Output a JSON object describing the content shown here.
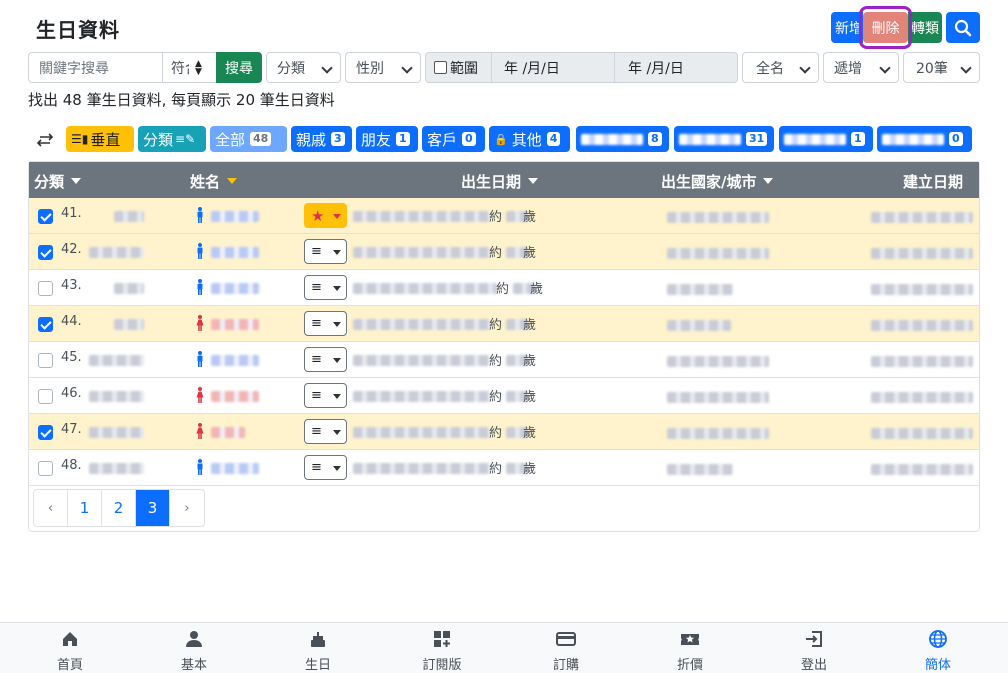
{
  "header": {
    "title": "生日資料",
    "new_label": "新增",
    "delete_label": "刪除",
    "classify_label": "轉類"
  },
  "filters": {
    "keyword_placeholder": "關鍵字搜尋",
    "match_value": "符合",
    "search_label": "搜尋",
    "category_value": "分類",
    "gender_value": "性別",
    "range_label": "範圍",
    "date_from": "年 /月/日",
    "date_to": "年 /月/日",
    "name_mode": "全名",
    "sort_value": "遞增",
    "page_size": "20筆"
  },
  "summary": "找出 48 筆生日資料, 每頁顯示 20 筆生日資料",
  "chips": {
    "vertical": "垂直",
    "classify": "分類",
    "all": {
      "label": "全部",
      "count": "48"
    },
    "relatives": {
      "label": "親戚",
      "count": "3"
    },
    "friends": {
      "label": "朋友",
      "count": "1"
    },
    "clients": {
      "label": "客戶",
      "count": "0"
    },
    "other": {
      "label": "其他",
      "count": "4"
    },
    "hidden1": {
      "count": "8"
    },
    "hidden2": {
      "count": "31"
    },
    "hidden3": {
      "count": "1"
    },
    "hidden4": {
      "count": "0"
    }
  },
  "table": {
    "headers": {
      "category": "分類",
      "name": "姓名",
      "birthdate": "出生日期",
      "birthplace": "出生國家/城市",
      "created": "建立日期"
    },
    "rows": [
      {
        "num": "41.",
        "checked": true,
        "gender": "male",
        "starred": true,
        "approx": "約",
        "age_unit": "歲"
      },
      {
        "num": "42.",
        "checked": true,
        "gender": "male",
        "starred": false,
        "approx": "約",
        "age_unit": "歲"
      },
      {
        "num": "43.",
        "checked": false,
        "gender": "male",
        "starred": false,
        "approx": "約",
        "age_unit": "歲"
      },
      {
        "num": "44.",
        "checked": true,
        "gender": "female",
        "starred": false,
        "approx": "約",
        "age_unit": "歲"
      },
      {
        "num": "45.",
        "checked": false,
        "gender": "male",
        "starred": false,
        "approx": "約",
        "age_unit": "歲"
      },
      {
        "num": "46.",
        "checked": false,
        "gender": "female",
        "starred": false,
        "approx": "約",
        "age_unit": "歲"
      },
      {
        "num": "47.",
        "checked": true,
        "gender": "female",
        "starred": false,
        "approx": "約",
        "age_unit": "歲"
      },
      {
        "num": "48.",
        "checked": false,
        "gender": "male",
        "starred": false,
        "approx": "約",
        "age_unit": "歲"
      }
    ]
  },
  "pagination": {
    "prev": "‹",
    "pages": [
      "1",
      "2",
      "3"
    ],
    "current": "3",
    "next": "›"
  },
  "footer": [
    {
      "label": "首頁",
      "icon": "home-icon"
    },
    {
      "label": "基本",
      "icon": "person-icon"
    },
    {
      "label": "生日",
      "icon": "cake-icon"
    },
    {
      "label": "訂閱版",
      "icon": "grid-plus-icon"
    },
    {
      "label": "訂購",
      "icon": "credit-card-icon"
    },
    {
      "label": "折價",
      "icon": "ticket-star-icon"
    },
    {
      "label": "登出",
      "icon": "logout-icon"
    },
    {
      "label": "簡体",
      "icon": "globe-icon",
      "active": true
    }
  ],
  "colors": {
    "primary": "#0d6efd",
    "success": "#198754",
    "warning": "#ffc107",
    "danger_light": "#e3847a",
    "highlight": "#a020c8",
    "selected_row": "#fff3cd",
    "header_grey": "#6c757d"
  }
}
